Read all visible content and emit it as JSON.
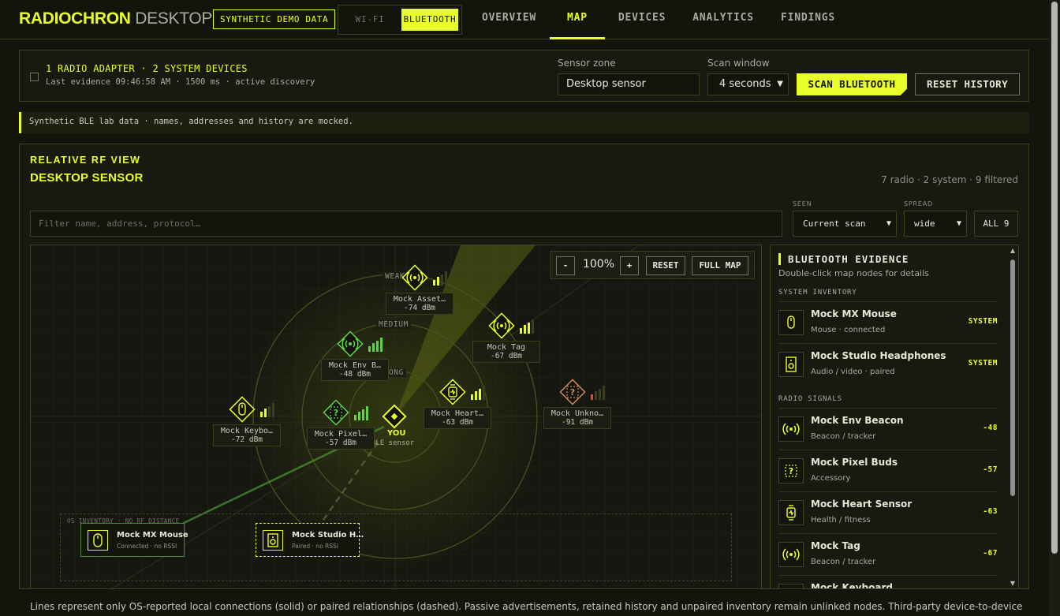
{
  "brand": {
    "primary": "RADIOCHRON",
    "secondary": "DESKTOP"
  },
  "demo_badge": "SYNTHETIC DEMO DATA",
  "radio_toggle": {
    "wifi": "WI-FI",
    "bluetooth": "BLUETOOTH",
    "selected": "BLUETOOTH"
  },
  "tabs": [
    "OVERVIEW",
    "MAP",
    "DEVICES",
    "ANALYTICS",
    "FINDINGS"
  ],
  "active_tab": "MAP",
  "status": {
    "title": "1 RADIO ADAPTER · 2 SYSTEM DEVICES",
    "subtitle": "Last evidence 09:46:58 AM · 1500 ms · active discovery",
    "sensor_zone_label": "Sensor zone",
    "sensor_zone_value": "Desktop sensor",
    "scan_window_label": "Scan window",
    "scan_window_value": "4 seconds",
    "scan_button": "SCAN BLUETOOTH",
    "reset_button": "RESET HISTORY"
  },
  "notice": "Synthetic BLE lab data · names, addresses and history are mocked.",
  "rf_view": {
    "kicker": "RELATIVE RF VIEW",
    "title": "DESKTOP SENSOR",
    "counts": "7 radio · 2 system · 9 filtered",
    "filter_placeholder": "Filter name, address, protocol…",
    "seen_label": "SEEN",
    "seen_value": "Current scan",
    "spread_label": "SPREAD",
    "spread_value": "wide",
    "all_button": "ALL 9"
  },
  "map": {
    "zoom": "100%",
    "zoom_out": "-",
    "zoom_in": "+",
    "reset": "RESET",
    "full_map": "FULL MAP",
    "rings": {
      "weak": "WEAK",
      "medium": "MEDIUM",
      "strong": "STRONG"
    },
    "center": {
      "label": "YOU",
      "sublabel": "BLE sensor"
    },
    "nodes": [
      {
        "name": "Mock Asset…",
        "rssi": "-74 dBm",
        "icon": "beacon-icon",
        "level": 2
      },
      {
        "name": "Mock Tag",
        "rssi": "-67 dBm",
        "icon": "beacon-icon",
        "level": 3
      },
      {
        "name": "Mock Env B…",
        "rssi": "-48 dBm",
        "icon": "beacon-icon",
        "level": 4
      },
      {
        "name": "Mock Heart…",
        "rssi": "-63 dBm",
        "icon": "watch-icon",
        "level": 3
      },
      {
        "name": "Mock Unkno…",
        "rssi": "-91 dBm",
        "icon": "unknown-icon",
        "level": 1
      },
      {
        "name": "Mock Keybo…",
        "rssi": "-72 dBm",
        "icon": "keyboard-icon",
        "level": 2
      },
      {
        "name": "Mock Pixel…",
        "rssi": "-57 dBm",
        "icon": "unknown-icon",
        "level": 4
      }
    ],
    "os_tray_label": "OS INVENTORY · NO RF DISTANCE",
    "os_devices": [
      {
        "name": "Mock MX Mouse",
        "detail": "Connected · no RSSI",
        "icon": "mouse-icon"
      },
      {
        "name": "Mock Studio H…",
        "detail": "Paired · no RSSI",
        "icon": "speaker-icon"
      }
    ]
  },
  "evidence": {
    "title": "BLUETOOTH EVIDENCE",
    "subtitle": "Double-click map nodes for details",
    "system_section": "SYSTEM INVENTORY",
    "radio_section": "RADIO SIGNALS",
    "system_items": [
      {
        "name": "Mock MX Mouse",
        "meta": "Mouse · connected",
        "value": "SYSTEM",
        "icon": "mouse-icon"
      },
      {
        "name": "Mock Studio Headphones",
        "meta": "Audio / video · paired",
        "value": "SYSTEM",
        "icon": "speaker-icon"
      }
    ],
    "radio_items": [
      {
        "name": "Mock Env Beacon",
        "meta": "Beacon / tracker",
        "value": "-48",
        "icon": "beacon-icon"
      },
      {
        "name": "Mock Pixel Buds",
        "meta": "Accessory",
        "value": "-57",
        "icon": "unknown-icon"
      },
      {
        "name": "Mock Heart Sensor",
        "meta": "Health / fitness",
        "value": "-63",
        "icon": "watch-icon"
      },
      {
        "name": "Mock Tag",
        "meta": "Beacon / tracker",
        "value": "-67",
        "icon": "beacon-icon"
      },
      {
        "name": "Mock Keyboard",
        "meta": "",
        "value": "",
        "icon": "keyboard-icon"
      }
    ]
  },
  "footnote": "Lines represent only OS-reported local connections (solid) or paired relationships (dashed). Passive advertisements, retained history and unpaired inventory remain unlinked nodes. Third-party device-to-device connections are not",
  "colors": {
    "accent": "#eaff2a",
    "background": "#13150d",
    "strong_signal": "#62d24a",
    "weak_signal": "#e04a3a",
    "unknown_node": "#d08a5a"
  }
}
